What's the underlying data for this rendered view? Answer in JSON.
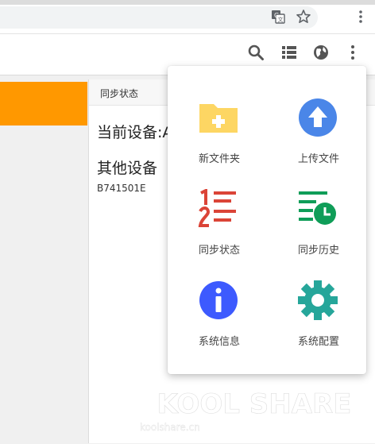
{
  "page": {
    "card": {
      "header_title": "同步状态",
      "current_device": "当前设备:A",
      "other_devices": "其他设备",
      "device_id": "B741501E"
    }
  },
  "menu": {
    "items": [
      {
        "label": "新文件夹",
        "icon": "folder-plus-icon",
        "color": "#fdd663"
      },
      {
        "label": "上传文件",
        "icon": "upload-icon",
        "color": "#4a86e8"
      },
      {
        "label": "同步状态",
        "icon": "numbered-list-icon",
        "color": "#db4437"
      },
      {
        "label": "同步历史",
        "icon": "history-icon",
        "color": "#0f9d58"
      },
      {
        "label": "系统信息",
        "icon": "info-icon",
        "color": "#3d5afe"
      },
      {
        "label": "系统配置",
        "icon": "gear-icon",
        "color": "#26a69a"
      }
    ]
  },
  "watermark": {
    "brand_text": "KOOL SHARE",
    "site": "koolshare.cn"
  },
  "colors": {
    "accent": "#ff9800"
  }
}
